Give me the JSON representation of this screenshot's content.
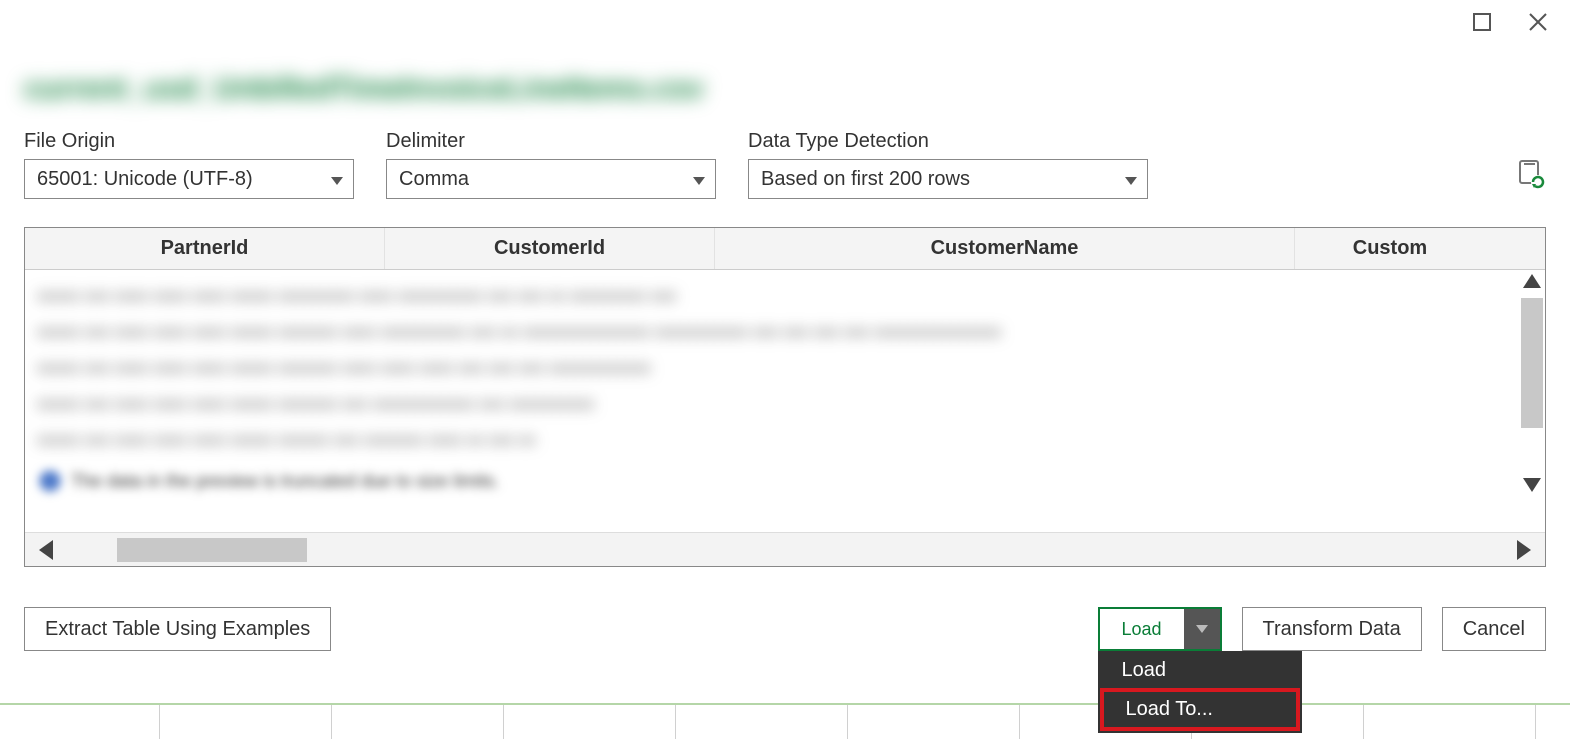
{
  "filename": "current_usd_UnbilledTimeInvoiceLineItems.csv",
  "controls": {
    "fileOriginLabel": "File Origin",
    "fileOriginValue": "65001: Unicode (UTF-8)",
    "delimiterLabel": "Delimiter",
    "delimiterValue": "Comma",
    "dataTypeLabel": "Data Type Detection",
    "dataTypeValue": "Based on first 200 rows"
  },
  "grid": {
    "headers": {
      "c1": "PartnerId",
      "c2": "CustomerId",
      "c3": "CustomerName",
      "c4": "Custom"
    },
    "blurredRows": [
      "xxxxx xxx xxxx xxxx xxxx xxxxx   xxxxxxxxx xxxx xxxxxxxxxx xxx   xxx xx xxxxxxxxx xxx",
      "xxxxx xxx xxxx xxxx xxxx xxxxx   xxxxxxx xxxx xxxxxxxxxx xxx   xx xxxxxxxxxxxxxxx xxxxxxxxxxx xxx xxx xxx xxx   xxxxxxxxxxxxxxx",
      "xxxxx xxx xxxx xxxx xxxx xxxxx   xxxxxxx xxxx xxxx xxxx xxx   xxx  xxx  xxxxxxxxxxxx",
      "xxxxx xxx xxxx xxxx xxxx xxxxx   xxxxxxx xxx xxxxxxxxxxxx   xxx  xxxxxxxxxx",
      "xxxxx xxx xxxx xxxx xxxx xxxxx   xxxxxx xxx xxxxxxx xxxx   xx  xxx  xx"
    ],
    "infoText": "The data in the preview is truncated due to size limits."
  },
  "footer": {
    "extract": "Extract Table Using Examples",
    "load": "Load",
    "transform": "Transform Data",
    "cancel": "Cancel"
  },
  "loadMenu": {
    "item1": "Load",
    "item2": "Load To..."
  }
}
